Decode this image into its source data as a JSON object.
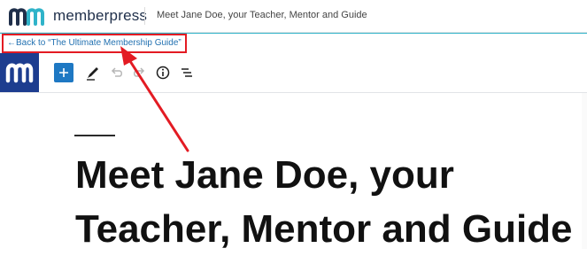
{
  "header": {
    "brand": "memberpress",
    "page_title": "Meet Jane Doe, your Teacher, Mentor and Guide"
  },
  "back_link": {
    "label": "←Back to “The Ultimate Membership Guide”"
  },
  "toolbar": {
    "icons": [
      "site-logo-icon",
      "add-block-icon",
      "edit-pencil-icon",
      "undo-icon",
      "redo-icon",
      "info-icon",
      "list-view-icon"
    ]
  },
  "editor": {
    "headline": "Meet Jane Doe, your Teacher, Mentor and Guide"
  },
  "colors": {
    "brand_teal": "#2fb3c9",
    "brand_navy": "#1d3d8f",
    "add_button_blue": "#1e78c3",
    "annotation_red": "#e31b23",
    "link_blue": "#2271b1"
  }
}
